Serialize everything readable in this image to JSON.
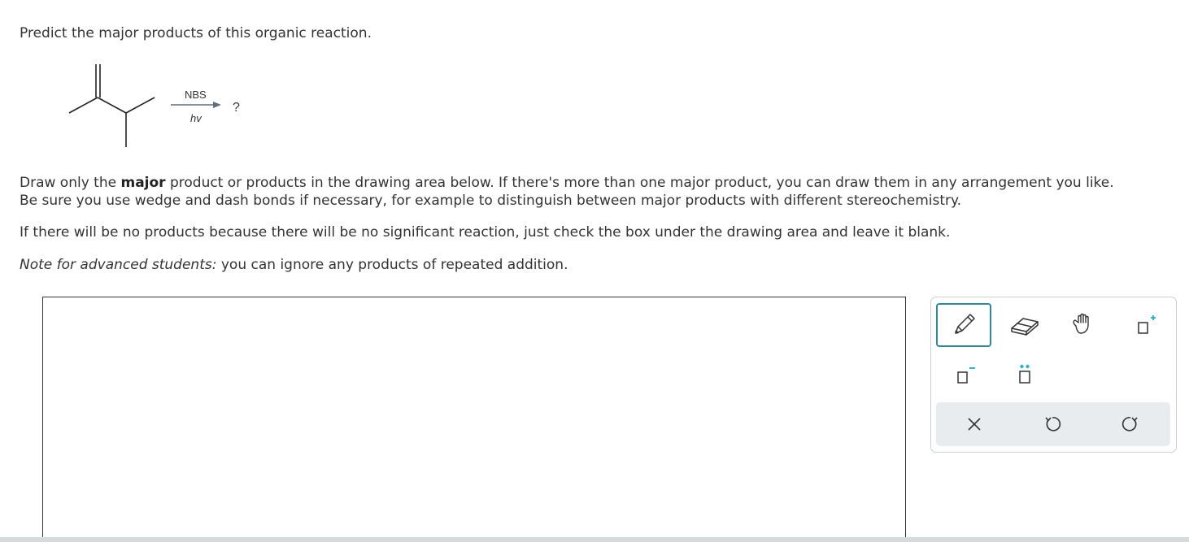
{
  "question": {
    "title": "Predict the major products of this organic reaction."
  },
  "reaction": {
    "reagent_top": "NBS",
    "reagent_bottom": "hv",
    "product": "?"
  },
  "instructions": {
    "p1_a": "Draw only the ",
    "p1_bold": "major",
    "p1_b": " product or products in the drawing area below. If there's more than one major product, you can draw them in any arrangement you like.",
    "p1_c": "Be sure you use wedge and dash bonds if necessary, for example to distinguish between major products with different stereochemistry.",
    "p2": "If there will be no products because there will be no significant reaction, just check the box under the drawing area and leave it blank.",
    "p3_italic": "Note for advanced students:",
    "p3_rest": " you can ignore any products of repeated addition."
  },
  "toolbar": {
    "tools": [
      "pencil-icon",
      "eraser-icon",
      "hand-icon",
      "positive-charge-icon",
      "negative-charge-icon",
      "lone-pair-icon"
    ],
    "actions": [
      "clear-icon",
      "undo-icon",
      "redo-icon"
    ],
    "accent_color": "#2b8a9e",
    "charge_color": "#2fb1cf"
  }
}
